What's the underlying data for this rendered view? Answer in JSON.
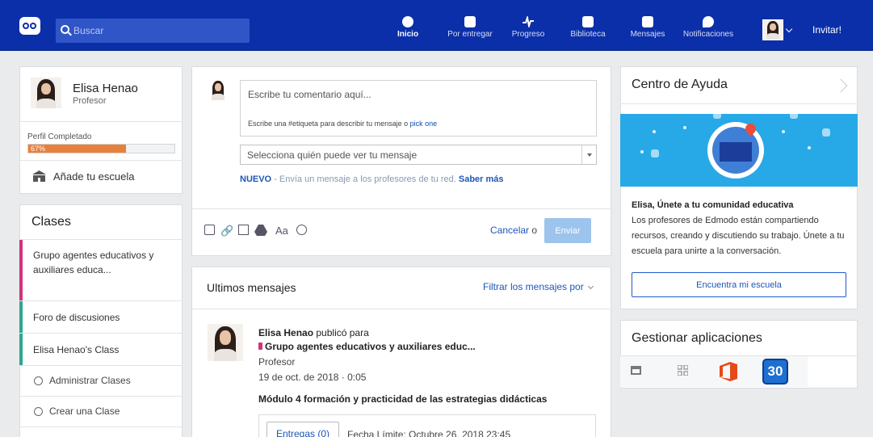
{
  "topbar": {
    "search_placeholder": "Buscar",
    "nav": [
      {
        "label": "Inicio",
        "icon": "home-icon",
        "active": true
      },
      {
        "label": "Por entregar",
        "icon": "calendar-check-icon",
        "active": false
      },
      {
        "label": "Progreso",
        "icon": "pulse-icon",
        "active": false
      },
      {
        "label": "Biblioteca",
        "icon": "library-icon",
        "active": false
      },
      {
        "label": "Mensajes",
        "icon": "chat-icon",
        "active": false
      },
      {
        "label": "Notificaciones",
        "icon": "notification-icon",
        "active": false
      }
    ],
    "invite_label": "Invitar!"
  },
  "profile": {
    "name": "Elisa Henao",
    "role": "Profesor",
    "completion_label": "Perfil Completado",
    "completion_text": "67%",
    "completion_fraction": 0.67,
    "add_school_label": "Añade tu escuela"
  },
  "classes": {
    "title": "Clases",
    "items": [
      {
        "label": "Grupo agentes educativos y auxiliares educa...",
        "color": "#d2317e"
      },
      {
        "label": "Foro de discusiones",
        "color": "#2aa790"
      },
      {
        "label": "Elisa Henao's Class",
        "color": "#2aa790"
      }
    ],
    "manage_label": "Administrar Clases",
    "create_label": "Crear una Clase"
  },
  "composer": {
    "placeholder": "Escribe tu comentario aquí...",
    "hint_text": "Escribe una #etiqueta para describir tu mensaje o",
    "hint_link": "pick one",
    "audience_placeholder": "Selecciona quién puede ver tu mensaje",
    "nuevo_label": "NUEVO",
    "nuevo_text": "- Envía un mensaje a los profesores de tu red.",
    "saber_mas": "Saber más",
    "cancel_label": "Cancelar",
    "or_text": "o",
    "send_label": "Enviar"
  },
  "messages": {
    "title": "Ultimos mensajes",
    "filter_label": "Filtrar los mensajes por",
    "post": {
      "author": "Elisa Henao",
      "published_for": "publicó para",
      "group": "Grupo agentes educativos y auxiliares educ...",
      "role": "Profesor",
      "date": "19 de oct. de 2018 · 0:05",
      "body": "Módulo 4 formación y practicidad de las estrategias didácticas",
      "entregas_label": "Entregas (0)",
      "deadline": "Fecha Límite: Octubre 26, 2018 23:45"
    }
  },
  "help_center": {
    "title": "Centro de Ayuda",
    "headline": "Elisa, Únete a tu comunidad educativa",
    "body": "Los profesores de Edmodo están compartiendo recursos, creando y discutiendo su trabajo. Únete a tu escuela para unirte a la conversación.",
    "button_label": "Encuentra mi escuela"
  },
  "apps": {
    "title": "Gestionar aplicaciones",
    "calendar_day": "30"
  }
}
